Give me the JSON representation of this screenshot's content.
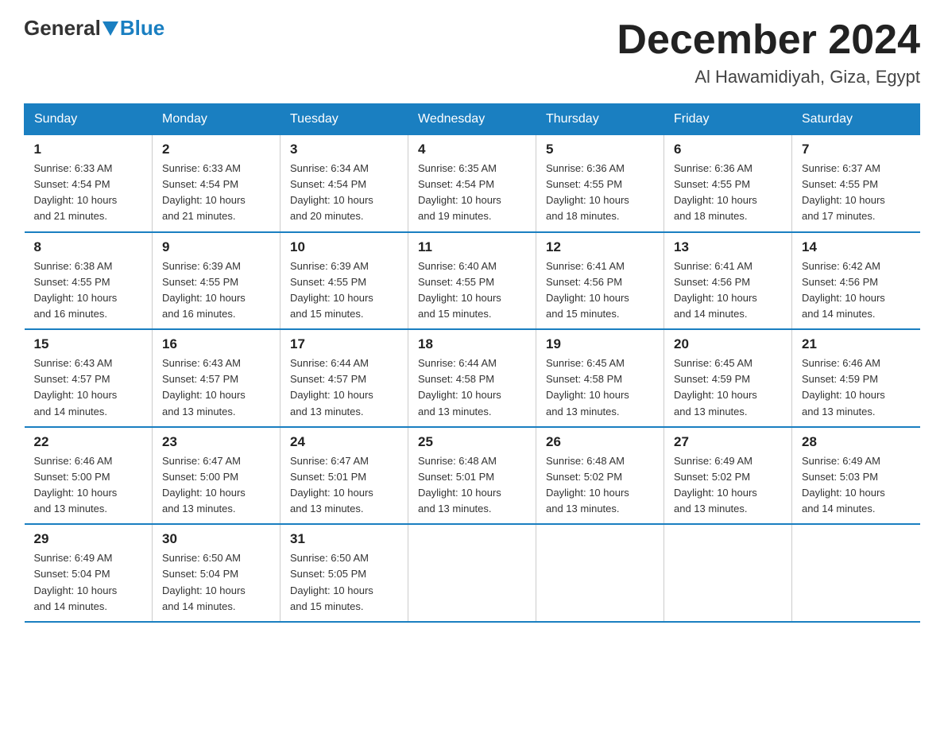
{
  "header": {
    "logo_general": "General",
    "logo_blue": "Blue",
    "month_title": "December 2024",
    "location": "Al Hawamidiyah, Giza, Egypt"
  },
  "days_of_week": [
    "Sunday",
    "Monday",
    "Tuesday",
    "Wednesday",
    "Thursday",
    "Friday",
    "Saturday"
  ],
  "weeks": [
    [
      {
        "day": "1",
        "info": "Sunrise: 6:33 AM\nSunset: 4:54 PM\nDaylight: 10 hours\nand 21 minutes."
      },
      {
        "day": "2",
        "info": "Sunrise: 6:33 AM\nSunset: 4:54 PM\nDaylight: 10 hours\nand 21 minutes."
      },
      {
        "day": "3",
        "info": "Sunrise: 6:34 AM\nSunset: 4:54 PM\nDaylight: 10 hours\nand 20 minutes."
      },
      {
        "day": "4",
        "info": "Sunrise: 6:35 AM\nSunset: 4:54 PM\nDaylight: 10 hours\nand 19 minutes."
      },
      {
        "day": "5",
        "info": "Sunrise: 6:36 AM\nSunset: 4:55 PM\nDaylight: 10 hours\nand 18 minutes."
      },
      {
        "day": "6",
        "info": "Sunrise: 6:36 AM\nSunset: 4:55 PM\nDaylight: 10 hours\nand 18 minutes."
      },
      {
        "day": "7",
        "info": "Sunrise: 6:37 AM\nSunset: 4:55 PM\nDaylight: 10 hours\nand 17 minutes."
      }
    ],
    [
      {
        "day": "8",
        "info": "Sunrise: 6:38 AM\nSunset: 4:55 PM\nDaylight: 10 hours\nand 16 minutes."
      },
      {
        "day": "9",
        "info": "Sunrise: 6:39 AM\nSunset: 4:55 PM\nDaylight: 10 hours\nand 16 minutes."
      },
      {
        "day": "10",
        "info": "Sunrise: 6:39 AM\nSunset: 4:55 PM\nDaylight: 10 hours\nand 15 minutes."
      },
      {
        "day": "11",
        "info": "Sunrise: 6:40 AM\nSunset: 4:55 PM\nDaylight: 10 hours\nand 15 minutes."
      },
      {
        "day": "12",
        "info": "Sunrise: 6:41 AM\nSunset: 4:56 PM\nDaylight: 10 hours\nand 15 minutes."
      },
      {
        "day": "13",
        "info": "Sunrise: 6:41 AM\nSunset: 4:56 PM\nDaylight: 10 hours\nand 14 minutes."
      },
      {
        "day": "14",
        "info": "Sunrise: 6:42 AM\nSunset: 4:56 PM\nDaylight: 10 hours\nand 14 minutes."
      }
    ],
    [
      {
        "day": "15",
        "info": "Sunrise: 6:43 AM\nSunset: 4:57 PM\nDaylight: 10 hours\nand 14 minutes."
      },
      {
        "day": "16",
        "info": "Sunrise: 6:43 AM\nSunset: 4:57 PM\nDaylight: 10 hours\nand 13 minutes."
      },
      {
        "day": "17",
        "info": "Sunrise: 6:44 AM\nSunset: 4:57 PM\nDaylight: 10 hours\nand 13 minutes."
      },
      {
        "day": "18",
        "info": "Sunrise: 6:44 AM\nSunset: 4:58 PM\nDaylight: 10 hours\nand 13 minutes."
      },
      {
        "day": "19",
        "info": "Sunrise: 6:45 AM\nSunset: 4:58 PM\nDaylight: 10 hours\nand 13 minutes."
      },
      {
        "day": "20",
        "info": "Sunrise: 6:45 AM\nSunset: 4:59 PM\nDaylight: 10 hours\nand 13 minutes."
      },
      {
        "day": "21",
        "info": "Sunrise: 6:46 AM\nSunset: 4:59 PM\nDaylight: 10 hours\nand 13 minutes."
      }
    ],
    [
      {
        "day": "22",
        "info": "Sunrise: 6:46 AM\nSunset: 5:00 PM\nDaylight: 10 hours\nand 13 minutes."
      },
      {
        "day": "23",
        "info": "Sunrise: 6:47 AM\nSunset: 5:00 PM\nDaylight: 10 hours\nand 13 minutes."
      },
      {
        "day": "24",
        "info": "Sunrise: 6:47 AM\nSunset: 5:01 PM\nDaylight: 10 hours\nand 13 minutes."
      },
      {
        "day": "25",
        "info": "Sunrise: 6:48 AM\nSunset: 5:01 PM\nDaylight: 10 hours\nand 13 minutes."
      },
      {
        "day": "26",
        "info": "Sunrise: 6:48 AM\nSunset: 5:02 PM\nDaylight: 10 hours\nand 13 minutes."
      },
      {
        "day": "27",
        "info": "Sunrise: 6:49 AM\nSunset: 5:02 PM\nDaylight: 10 hours\nand 13 minutes."
      },
      {
        "day": "28",
        "info": "Sunrise: 6:49 AM\nSunset: 5:03 PM\nDaylight: 10 hours\nand 14 minutes."
      }
    ],
    [
      {
        "day": "29",
        "info": "Sunrise: 6:49 AM\nSunset: 5:04 PM\nDaylight: 10 hours\nand 14 minutes."
      },
      {
        "day": "30",
        "info": "Sunrise: 6:50 AM\nSunset: 5:04 PM\nDaylight: 10 hours\nand 14 minutes."
      },
      {
        "day": "31",
        "info": "Sunrise: 6:50 AM\nSunset: 5:05 PM\nDaylight: 10 hours\nand 15 minutes."
      },
      {
        "day": "",
        "info": ""
      },
      {
        "day": "",
        "info": ""
      },
      {
        "day": "",
        "info": ""
      },
      {
        "day": "",
        "info": ""
      }
    ]
  ]
}
